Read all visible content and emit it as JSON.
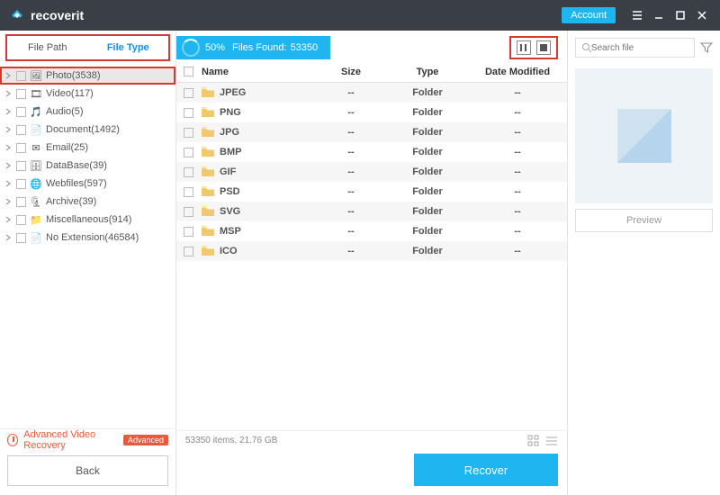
{
  "app": {
    "name": "recoverit"
  },
  "titlebar": {
    "account": "Account"
  },
  "tabs": {
    "path": "File Path",
    "type": "File Type"
  },
  "tree": [
    {
      "label": "Photo(3538)",
      "selected": true,
      "icon": "image"
    },
    {
      "label": "Video(117)",
      "icon": "video"
    },
    {
      "label": "Audio(5)",
      "icon": "audio"
    },
    {
      "label": "Document(1492)",
      "icon": "doc"
    },
    {
      "label": "Email(25)",
      "icon": "mail"
    },
    {
      "label": "DataBase(39)",
      "icon": "db"
    },
    {
      "label": "Webfiles(597)",
      "icon": "web"
    },
    {
      "label": "Archive(39)",
      "icon": "zip"
    },
    {
      "label": "Miscellaneous(914)",
      "icon": "misc"
    },
    {
      "label": "No Extension(46584)",
      "icon": "none"
    }
  ],
  "advanced": {
    "label": "Advanced Video Recovery",
    "badge": "Advanced"
  },
  "scan": {
    "percent": "50%",
    "found_label": "Files Found:",
    "found_count": "53350"
  },
  "columns": {
    "name": "Name",
    "size": "Size",
    "type": "Type",
    "date": "Date Modified"
  },
  "rows": [
    {
      "name": "JPEG",
      "size": "--",
      "type": "Folder",
      "date": "--"
    },
    {
      "name": "PNG",
      "size": "--",
      "type": "Folder",
      "date": "--"
    },
    {
      "name": "JPG",
      "size": "--",
      "type": "Folder",
      "date": "--"
    },
    {
      "name": "BMP",
      "size": "--",
      "type": "Folder",
      "date": "--"
    },
    {
      "name": "GIF",
      "size": "--",
      "type": "Folder",
      "date": "--"
    },
    {
      "name": "PSD",
      "size": "--",
      "type": "Folder",
      "date": "--"
    },
    {
      "name": "SVG",
      "size": "--",
      "type": "Folder",
      "date": "--"
    },
    {
      "name": "MSP",
      "size": "--",
      "type": "Folder",
      "date": "--"
    },
    {
      "name": "ICO",
      "size": "--",
      "type": "Folder",
      "date": "--"
    }
  ],
  "status": {
    "text": "53350 items, 21.76  GB"
  },
  "buttons": {
    "back": "Back",
    "recover": "Recover",
    "preview": "Preview"
  },
  "search": {
    "placeholder": "Search file"
  }
}
